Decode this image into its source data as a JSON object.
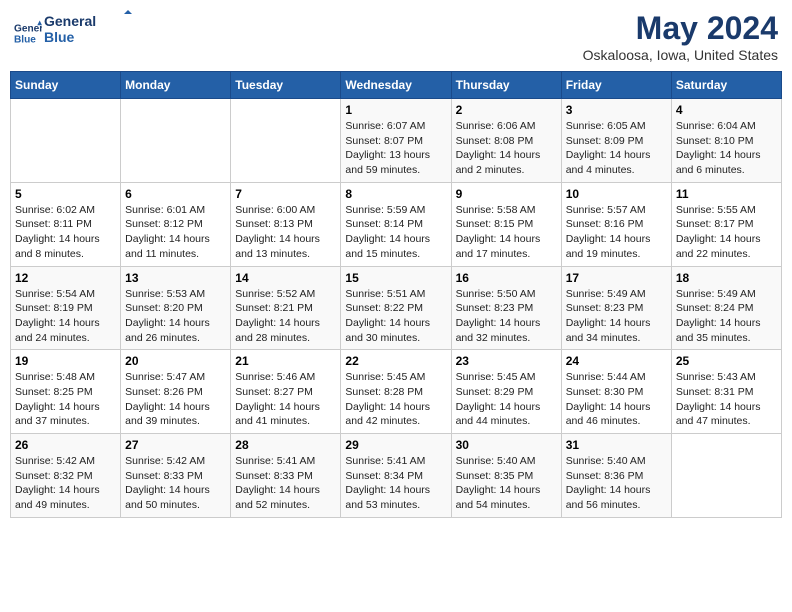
{
  "header": {
    "logo_line1": "General",
    "logo_line2": "Blue",
    "main_title": "May 2024",
    "subtitle": "Oskaloosa, Iowa, United States"
  },
  "days_of_week": [
    "Sunday",
    "Monday",
    "Tuesday",
    "Wednesday",
    "Thursday",
    "Friday",
    "Saturday"
  ],
  "weeks": [
    [
      {
        "num": "",
        "info": ""
      },
      {
        "num": "",
        "info": ""
      },
      {
        "num": "",
        "info": ""
      },
      {
        "num": "1",
        "info": "Sunrise: 6:07 AM\nSunset: 8:07 PM\nDaylight: 13 hours\nand 59 minutes."
      },
      {
        "num": "2",
        "info": "Sunrise: 6:06 AM\nSunset: 8:08 PM\nDaylight: 14 hours\nand 2 minutes."
      },
      {
        "num": "3",
        "info": "Sunrise: 6:05 AM\nSunset: 8:09 PM\nDaylight: 14 hours\nand 4 minutes."
      },
      {
        "num": "4",
        "info": "Sunrise: 6:04 AM\nSunset: 8:10 PM\nDaylight: 14 hours\nand 6 minutes."
      }
    ],
    [
      {
        "num": "5",
        "info": "Sunrise: 6:02 AM\nSunset: 8:11 PM\nDaylight: 14 hours\nand 8 minutes."
      },
      {
        "num": "6",
        "info": "Sunrise: 6:01 AM\nSunset: 8:12 PM\nDaylight: 14 hours\nand 11 minutes."
      },
      {
        "num": "7",
        "info": "Sunrise: 6:00 AM\nSunset: 8:13 PM\nDaylight: 14 hours\nand 13 minutes."
      },
      {
        "num": "8",
        "info": "Sunrise: 5:59 AM\nSunset: 8:14 PM\nDaylight: 14 hours\nand 15 minutes."
      },
      {
        "num": "9",
        "info": "Sunrise: 5:58 AM\nSunset: 8:15 PM\nDaylight: 14 hours\nand 17 minutes."
      },
      {
        "num": "10",
        "info": "Sunrise: 5:57 AM\nSunset: 8:16 PM\nDaylight: 14 hours\nand 19 minutes."
      },
      {
        "num": "11",
        "info": "Sunrise: 5:55 AM\nSunset: 8:17 PM\nDaylight: 14 hours\nand 22 minutes."
      }
    ],
    [
      {
        "num": "12",
        "info": "Sunrise: 5:54 AM\nSunset: 8:19 PM\nDaylight: 14 hours\nand 24 minutes."
      },
      {
        "num": "13",
        "info": "Sunrise: 5:53 AM\nSunset: 8:20 PM\nDaylight: 14 hours\nand 26 minutes."
      },
      {
        "num": "14",
        "info": "Sunrise: 5:52 AM\nSunset: 8:21 PM\nDaylight: 14 hours\nand 28 minutes."
      },
      {
        "num": "15",
        "info": "Sunrise: 5:51 AM\nSunset: 8:22 PM\nDaylight: 14 hours\nand 30 minutes."
      },
      {
        "num": "16",
        "info": "Sunrise: 5:50 AM\nSunset: 8:23 PM\nDaylight: 14 hours\nand 32 minutes."
      },
      {
        "num": "17",
        "info": "Sunrise: 5:49 AM\nSunset: 8:23 PM\nDaylight: 14 hours\nand 34 minutes."
      },
      {
        "num": "18",
        "info": "Sunrise: 5:49 AM\nSunset: 8:24 PM\nDaylight: 14 hours\nand 35 minutes."
      }
    ],
    [
      {
        "num": "19",
        "info": "Sunrise: 5:48 AM\nSunset: 8:25 PM\nDaylight: 14 hours\nand 37 minutes."
      },
      {
        "num": "20",
        "info": "Sunrise: 5:47 AM\nSunset: 8:26 PM\nDaylight: 14 hours\nand 39 minutes."
      },
      {
        "num": "21",
        "info": "Sunrise: 5:46 AM\nSunset: 8:27 PM\nDaylight: 14 hours\nand 41 minutes."
      },
      {
        "num": "22",
        "info": "Sunrise: 5:45 AM\nSunset: 8:28 PM\nDaylight: 14 hours\nand 42 minutes."
      },
      {
        "num": "23",
        "info": "Sunrise: 5:45 AM\nSunset: 8:29 PM\nDaylight: 14 hours\nand 44 minutes."
      },
      {
        "num": "24",
        "info": "Sunrise: 5:44 AM\nSunset: 8:30 PM\nDaylight: 14 hours\nand 46 minutes."
      },
      {
        "num": "25",
        "info": "Sunrise: 5:43 AM\nSunset: 8:31 PM\nDaylight: 14 hours\nand 47 minutes."
      }
    ],
    [
      {
        "num": "26",
        "info": "Sunrise: 5:42 AM\nSunset: 8:32 PM\nDaylight: 14 hours\nand 49 minutes."
      },
      {
        "num": "27",
        "info": "Sunrise: 5:42 AM\nSunset: 8:33 PM\nDaylight: 14 hours\nand 50 minutes."
      },
      {
        "num": "28",
        "info": "Sunrise: 5:41 AM\nSunset: 8:33 PM\nDaylight: 14 hours\nand 52 minutes."
      },
      {
        "num": "29",
        "info": "Sunrise: 5:41 AM\nSunset: 8:34 PM\nDaylight: 14 hours\nand 53 minutes."
      },
      {
        "num": "30",
        "info": "Sunrise: 5:40 AM\nSunset: 8:35 PM\nDaylight: 14 hours\nand 54 minutes."
      },
      {
        "num": "31",
        "info": "Sunrise: 5:40 AM\nSunset: 8:36 PM\nDaylight: 14 hours\nand 56 minutes."
      },
      {
        "num": "",
        "info": ""
      }
    ]
  ]
}
